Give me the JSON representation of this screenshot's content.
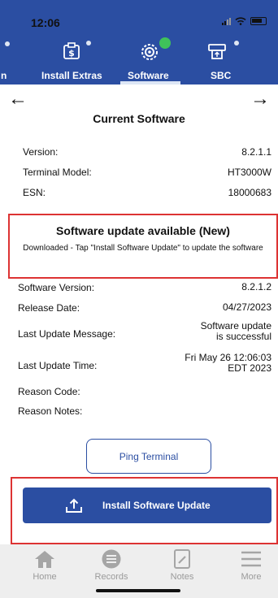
{
  "status_bar": {
    "time": "12:06"
  },
  "top_tabs": [
    {
      "label": "n"
    },
    {
      "label": "Install Extras"
    },
    {
      "label": "Software"
    },
    {
      "label": "SBC"
    }
  ],
  "nav": {
    "back": "←",
    "forward": "→",
    "title": "Current Software"
  },
  "current": [
    {
      "label": "Version:",
      "value": "8.2.1.1"
    },
    {
      "label": "Terminal Model:",
      "value": "HT3000W"
    },
    {
      "label": "ESN:",
      "value": "18000683"
    }
  ],
  "update_notice": {
    "heading": "Software update available (New)",
    "message": "Downloaded - Tap \"Install Software Update\" to update the software"
  },
  "details": [
    {
      "label": "Software Version:",
      "value": "8.2.1.2"
    },
    {
      "label": "Release Date:",
      "value": "04/27/2023"
    },
    {
      "label": "Last Update Message:",
      "value1": "Software update",
      "value2": "is successful"
    },
    {
      "label": "Last Update Time:",
      "value1": "Fri May 26 12:06:03",
      "value2": "EDT 2023"
    },
    {
      "label": "Reason Code:",
      "value": ""
    },
    {
      "label": "Reason Notes:",
      "value": ""
    }
  ],
  "buttons": {
    "ping": "Ping Terminal",
    "install": "Install Software Update"
  },
  "bottom_nav": [
    {
      "label": "Home",
      "icon": "home-icon"
    },
    {
      "label": "Records",
      "icon": "records-icon"
    },
    {
      "label": "Notes",
      "icon": "notes-icon"
    },
    {
      "label": "More",
      "icon": "menu-icon"
    }
  ],
  "colors": {
    "brand": "#2b4ea2",
    "highlight": "#dd3333",
    "success": "#3fc25a"
  }
}
